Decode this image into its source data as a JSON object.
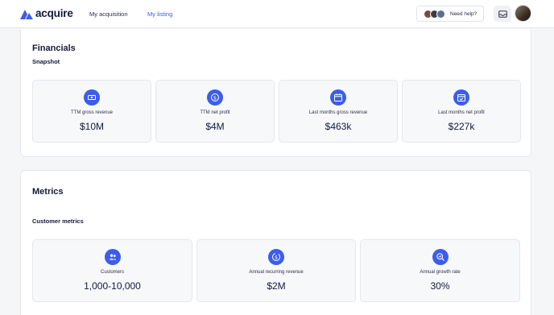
{
  "header": {
    "logo_text": "acquire",
    "nav": [
      {
        "label": "My acquisition"
      },
      {
        "label": "My listing"
      }
    ],
    "help_label": "Need help?",
    "help_avatar_colors": [
      "#7a4a3a",
      "#3b3b45",
      "#5a6e8c"
    ]
  },
  "colors": {
    "accent": "#3c5dec",
    "text": "#131a3c"
  },
  "financials": {
    "title": "Financials",
    "subtitle": "Snapshot",
    "stats": [
      {
        "label": "TTM gross revenue",
        "value": "$10M",
        "icon": "money-icon"
      },
      {
        "label": "TTM net profit",
        "value": "$4M",
        "icon": "dollar-coin-icon"
      },
      {
        "label": "Last months gross revenue",
        "value": "$463k",
        "icon": "calendar-money-icon"
      },
      {
        "label": "Last months net profit",
        "value": "$227k",
        "icon": "calendar-check-icon"
      }
    ]
  },
  "metrics": {
    "title": "Metrics",
    "subtitle": "Customer metrics",
    "stats": [
      {
        "label": "Customers",
        "value": "1,000-10,000",
        "icon": "users-icon"
      },
      {
        "label": "Annual recurring revenue",
        "value": "$2M",
        "icon": "recurring-revenue-icon"
      },
      {
        "label": "Annual growth rate",
        "value": "30%",
        "icon": "growth-search-icon"
      }
    ]
  }
}
